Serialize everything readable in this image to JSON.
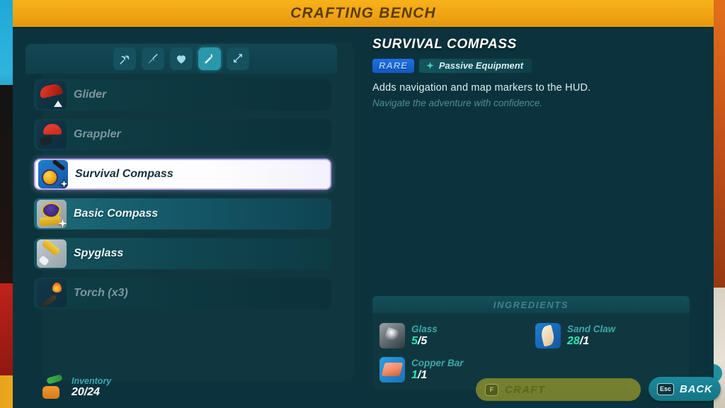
{
  "header": {
    "title": "CRAFTING BENCH"
  },
  "tabs": [
    {
      "name": "pickaxe",
      "icon": "pickaxe-icon",
      "active": false
    },
    {
      "name": "sword",
      "icon": "sword-icon",
      "active": false
    },
    {
      "name": "heart",
      "icon": "heart-icon",
      "active": false
    },
    {
      "name": "torch",
      "icon": "torch-icon",
      "active": true
    },
    {
      "name": "arrow",
      "icon": "arrow-icon",
      "active": false
    }
  ],
  "items": [
    {
      "label": "Glider",
      "state": "dim",
      "sparkle": false
    },
    {
      "label": "Grappler",
      "state": "dim",
      "sparkle": false
    },
    {
      "label": "Survival Compass",
      "state": "selected",
      "sparkle": true
    },
    {
      "label": "Basic Compass",
      "state": "bright",
      "sparkle": true
    },
    {
      "label": "Spyglass",
      "state": "normal",
      "sparkle": false
    },
    {
      "label": "Torch (x3)",
      "state": "dim",
      "sparkle": false
    }
  ],
  "detail": {
    "title": "SURVIVAL COMPASS",
    "rarity": "RARE",
    "type": "Passive Equipment",
    "description": "Adds navigation and map markers to the HUD.",
    "flavor": "Navigate the adventure with confidence."
  },
  "ingredients": {
    "header": "INGREDIENTS",
    "list": [
      {
        "name": "Glass",
        "have": "5",
        "need": "/5"
      },
      {
        "name": "Sand Claw",
        "have": "28",
        "need": "/1"
      },
      {
        "name": "Copper Bar",
        "have": "1",
        "need": "/1"
      }
    ]
  },
  "footer": {
    "inventory_label": "Inventory",
    "inventory_have": "20",
    "inventory_max": "/24",
    "craft_label": "CRAFT",
    "craft_key": "F",
    "back_label": "BACK",
    "back_key": "Esc"
  },
  "colors": {
    "banner": "#f0a413",
    "banner_text": "#5a3c0c",
    "panel": "#0c333d",
    "accent_teal": "#2a97ab",
    "rarity_blue": "#1f6fe0",
    "qty_green": "#2fe6b4",
    "selected_border": "#b9a9e8"
  }
}
